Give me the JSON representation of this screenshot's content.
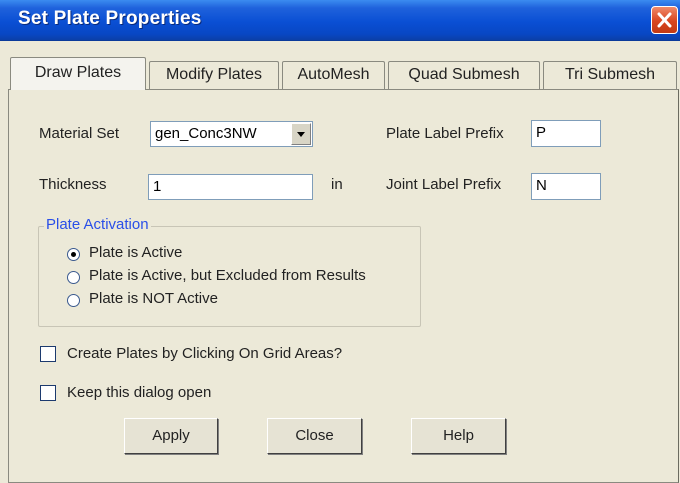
{
  "window": {
    "title": "Set Plate Properties"
  },
  "tabs": [
    {
      "label": "Draw Plates",
      "active": true
    },
    {
      "label": "Modify Plates",
      "active": false
    },
    {
      "label": "AutoMesh",
      "active": false
    },
    {
      "label": "Quad Submesh",
      "active": false
    },
    {
      "label": "Tri Submesh",
      "active": false
    }
  ],
  "form": {
    "material_set_label": "Material Set",
    "material_set_value": "gen_Conc3NW",
    "thickness_label": "Thickness",
    "thickness_value": "1",
    "thickness_unit": "in",
    "plate_label_prefix_label": "Plate Label Prefix",
    "plate_label_prefix_value": "P",
    "joint_label_prefix_label": "Joint Label Prefix",
    "joint_label_prefix_value": "N"
  },
  "activation": {
    "title": "Plate Activation",
    "options": [
      {
        "label": "Plate is Active",
        "selected": true
      },
      {
        "label": "Plate is Active, but Excluded from Results",
        "selected": false
      },
      {
        "label": "Plate is NOT Active",
        "selected": false
      }
    ]
  },
  "checkboxes": [
    {
      "label": "Create Plates by Clicking On Grid Areas?",
      "checked": false
    },
    {
      "label": "Keep this dialog open",
      "checked": false
    }
  ],
  "buttons": {
    "apply": "Apply",
    "close": "Close",
    "help": "Help"
  },
  "icons": {
    "close": "close-x-icon",
    "dropdown": "chevron-down-icon"
  },
  "colors": {
    "title_bar": "#0a4fd4",
    "dialog_bg": "#ece9d8",
    "group_title": "#2a4fe8",
    "close_button": "#d9451f"
  }
}
